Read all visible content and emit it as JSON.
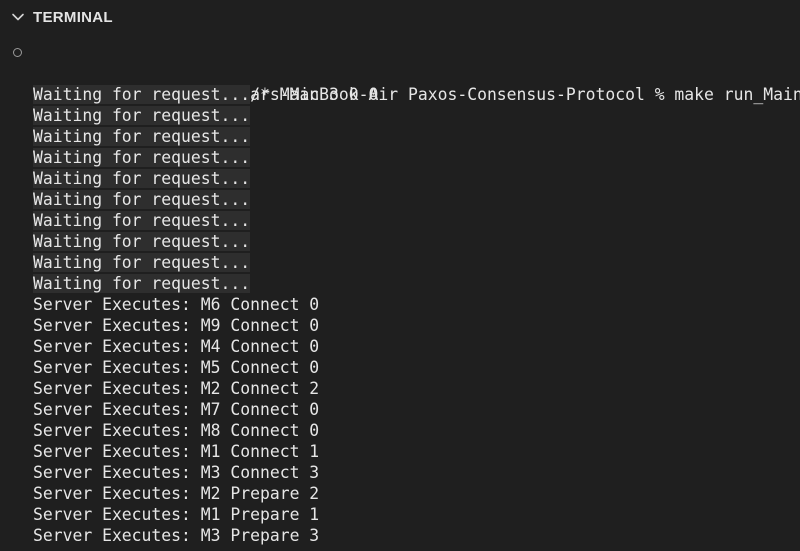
{
  "panel": {
    "title": "TERMINAL",
    "collapse_icon": "chevron-down-icon"
  },
  "terminal": {
    "prompt": "oscarelliott@Oscars-MacBook-Air Paxos-Consensus-Protocol % make run_Main",
    "command_echo": "java -cp .:./lib/* Main 3 0 0",
    "output": [
      "Waiting for request...",
      "Waiting for request...",
      "Waiting for request...",
      "Waiting for request...",
      "Waiting for request...",
      "Waiting for request...",
      "Waiting for request...",
      "Waiting for request...",
      "Waiting for request...",
      "Waiting for request...",
      "Server Executes: M6 Connect 0",
      "Server Executes: M9 Connect 0",
      "Server Executes: M4 Connect 0",
      "Server Executes: M5 Connect 0",
      "Server Executes: M2 Connect 2",
      "Server Executes: M7 Connect 0",
      "Server Executes: M8 Connect 0",
      "Server Executes: M1 Connect 1",
      "Server Executes: M3 Connect 3",
      "Server Executes: M2 Prepare 2",
      "Server Executes: M1 Prepare 1",
      "Server Executes: M3 Prepare 3"
    ]
  }
}
